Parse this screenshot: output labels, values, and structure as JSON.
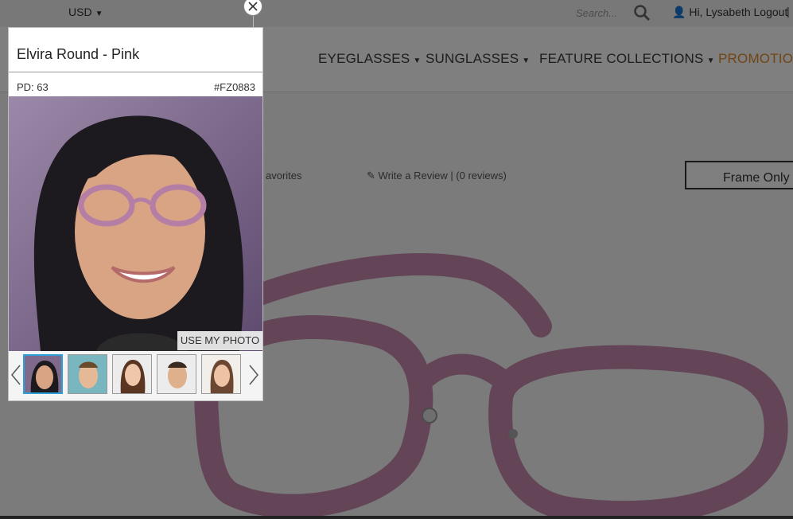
{
  "header": {
    "currency": "USD",
    "search_placeholder": "Search...",
    "user_text": "Hi, Lysabeth Logout",
    "separator": "|"
  },
  "nav": {
    "items": [
      {
        "label": "EYEGLASSES"
      },
      {
        "label": "SUNGLASSES"
      },
      {
        "label": "FEATURE COLLECTIONS"
      },
      {
        "label": "PROMOTIO"
      }
    ],
    "promo_color": "#e38a2a"
  },
  "product": {
    "favorites_text": "avorites",
    "review_text": "Write a Review | (0 reviews)",
    "lens_option": "Frame Only",
    "frame_color": "#c98bb0"
  },
  "popup": {
    "title": "Elvira Round - Pink",
    "pd": "PD: 63",
    "sku": "#FZ0883",
    "use_photo_label": "USE MY PHOTO",
    "thumbnails": [
      {
        "name": "model-1",
        "selected": true
      },
      {
        "name": "model-2",
        "selected": false
      },
      {
        "name": "model-3",
        "selected": false
      },
      {
        "name": "model-4",
        "selected": false
      },
      {
        "name": "model-5",
        "selected": false
      }
    ],
    "accent": "#2b9fd8"
  }
}
